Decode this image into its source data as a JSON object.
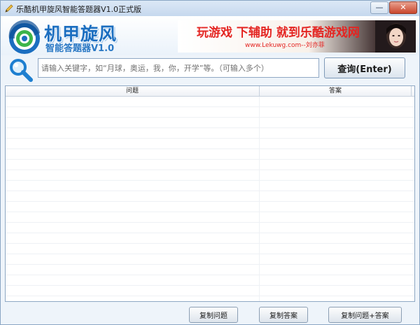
{
  "window": {
    "title": "乐酷机甲旋风智能答题器V1.0正式版",
    "minimize_glyph": "—",
    "close_glyph": "✕"
  },
  "logo": {
    "title": "机甲旋风",
    "subtitle": "智能答题器V1.0"
  },
  "banner": {
    "main_text": "玩游戏 下辅助 就到乐酷游戏网",
    "sub_text": "www.Lekuwg.com--刘亦菲"
  },
  "search": {
    "placeholder": "请输入关键字，如“月球，奥运，我，你，开学”等。（可输入多个）",
    "value": "",
    "button_label": "查询(Enter)"
  },
  "results": {
    "columns": [
      "问题",
      "答案"
    ],
    "rows": []
  },
  "actions": {
    "copy_question": "复制问题",
    "copy_answer": "复制答案",
    "copy_question_answer": "复制问题+答案"
  },
  "icons": {
    "title": "pen-icon",
    "logo": "swirl-logo-icon",
    "search": "magnifier-icon",
    "banner_photo": "portrait-photo"
  },
  "colors": {
    "brand_blue": "#1b6ec0",
    "banner_red": "#e42522",
    "close_red": "#c9452c"
  }
}
